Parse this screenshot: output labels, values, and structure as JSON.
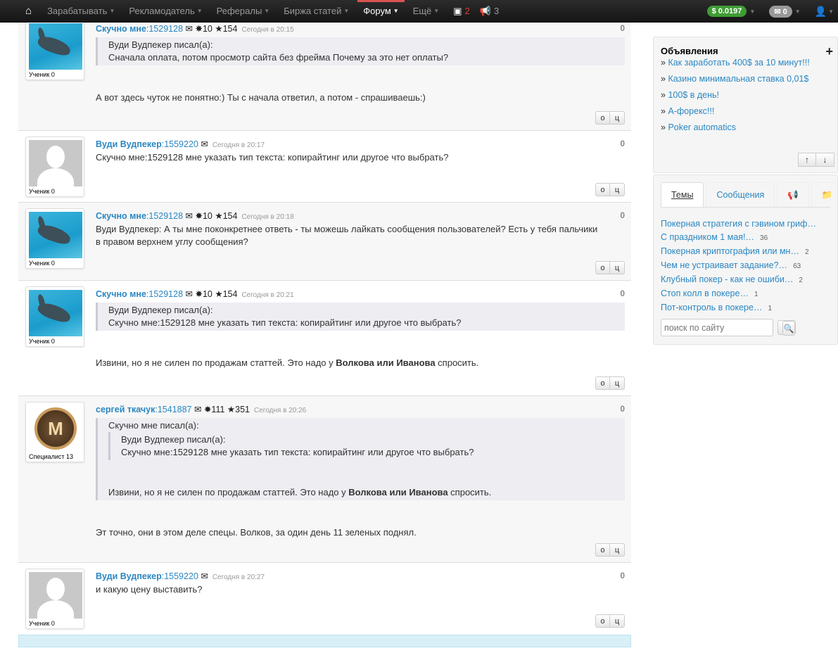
{
  "nav": {
    "items": [
      "Зарабатывать",
      "Рекламодатель",
      "Рефералы",
      "Биржа статей",
      "Форум",
      "Ещё"
    ],
    "inbox_count": "2",
    "announce_count": "3",
    "balance": "$ 0.0197",
    "messages": "0"
  },
  "posts": [
    {
      "name": "Скучно мне",
      "id": ":1529128",
      "stat1": "10",
      "stat2": "154",
      "time": "Сегодня в 20:15",
      "score": "0",
      "rank": "Ученик 0",
      "quote_author": "Вуди Вудпекер писал(а):",
      "quote_text": "Сначала оплата, потом просмотр сайта без фрейма Почему за это нет оплаты?",
      "text": "А вот здесь чуток не понятно:) Ты с начала ответил, а потом - спрашиваешь:)"
    },
    {
      "name": "Вуди Вудпекер",
      "id": ":1559220",
      "time": "Сегодня в 20:17",
      "score": "0",
      "rank": "Ученик 0",
      "text": "Скучно мне:1529128 мне указать тип текста: копирайтинг или другое что выбрать?"
    },
    {
      "name": "Скучно мне",
      "id": ":1529128",
      "stat1": "10",
      "stat2": "154",
      "time": "Сегодня в 20:18",
      "score": "0",
      "rank": "Ученик 0",
      "text": "Вуди Вудпекер: А ты мне поконкретнее ответь - ты можешь лайкать сообщения пользователей? Есть у тебя пальчики в правом верхнем углу сообщения?"
    },
    {
      "name": "Скучно мне",
      "id": ":1529128",
      "stat1": "10",
      "stat2": "154",
      "time": "Сегодня в 20:21",
      "score": "0",
      "rank": "Ученик 0",
      "quote_author": "Вуди Вудпекер писал(а):",
      "quote_text": "Скучно мне:1529128 мне указать тип текста: копирайтинг или другое что выбрать?",
      "text_a": "Извини, но я не силен по продажам статтей. Это надо у ",
      "text_bold": "Волкова или Иванова",
      "text_b": " спросить."
    },
    {
      "name": "сергей ткачук",
      "id": ":1541887",
      "stat1": "111",
      "stat2": "351",
      "time": "Сегодня в 20:26",
      "score": "0",
      "rank": "Специалист 13",
      "avatar_letter": "M",
      "quote_author": "Скучно мне писал(а):",
      "inner_quote_author": "Вуди Вудпекер писал(а):",
      "inner_quote_text": "Скучно мне:1529128 мне указать тип текста: копирайтинг или другое что выбрать?",
      "quote_text_a": "Извини, но я не силен по продажам статтей. Это надо у ",
      "quote_text_bold": "Волкова или Иванова",
      "quote_text_b": " спросить.",
      "text": "Эт точно, они в этом деле спецы. Волков, за один день 11 зеленых поднял."
    },
    {
      "name": "Вуди Вудпекер",
      "id": ":1559220",
      "time": "Сегодня в 20:27",
      "score": "0",
      "rank": "Ученик 0",
      "text": "и какую цену выставить?"
    }
  ],
  "vote_buttons": [
    "о",
    "ц"
  ],
  "sidebar": {
    "ads_title": "Объявления",
    "ads": [
      "Как заработать 400$ за 10 минут!!!",
      "Казино минимальная ставка 0,01$",
      "100$ в день!",
      "А-форекс!!!",
      "Poker automatics"
    ],
    "tabs": [
      "Темы",
      "Сообщения"
    ],
    "topics": [
      {
        "title": "Покерная стратегия с гэвином гриф…",
        "count": ""
      },
      {
        "title": "С праздником 1 мая!…",
        "count": "36"
      },
      {
        "title": "Покерная криптография или мн…",
        "count": "2"
      },
      {
        "title": "Чем не устраивает задание?…",
        "count": "63"
      },
      {
        "title": "Клубный покер - как не ошиби…",
        "count": "2"
      },
      {
        "title": "Стоп колл в покере…",
        "count": "1"
      },
      {
        "title": "Пот-контроль в покере…",
        "count": "1"
      }
    ],
    "search_placeholder": "поиск по сайту"
  }
}
